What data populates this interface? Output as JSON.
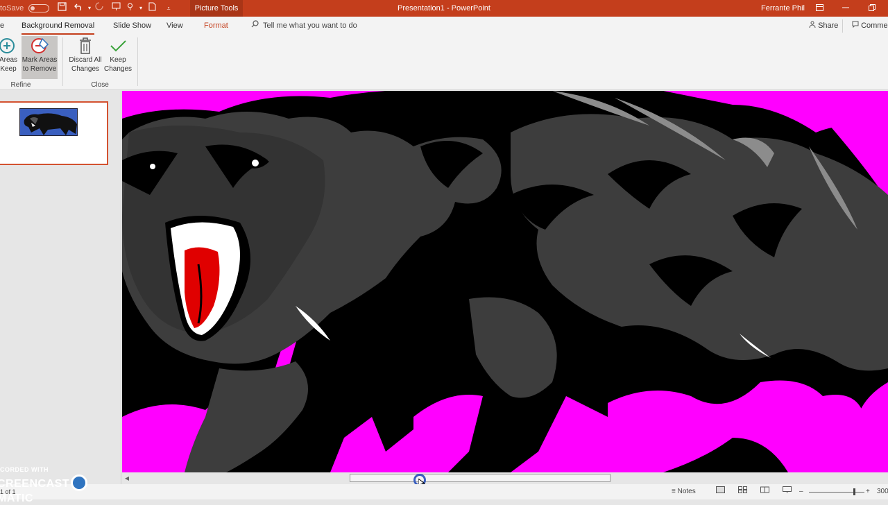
{
  "titlebar": {
    "autosave_label": "toSave",
    "autosave_state": "Off",
    "context_tab": "Picture Tools",
    "doc_title": "Presentation1 - PowerPoint",
    "user_name": "Ferrante Phil"
  },
  "tabs": {
    "file": "e",
    "background_removal": "Background Removal",
    "slide_show": "Slide Show",
    "view": "View",
    "format": "Format",
    "tell_me": "Tell me what you want to do",
    "share": "Share",
    "comments": "Comme"
  },
  "ribbon": {
    "mark_keep_line1": "Areas",
    "mark_keep_line2": "Keep",
    "mark_remove_line1": "Mark Areas",
    "mark_remove_line2": "to Remove",
    "discard_line1": "Discard All",
    "discard_line2": "Changes",
    "keep_line1": "Keep",
    "keep_line2": "Changes",
    "group_refine": "Refine",
    "group_close": "Close"
  },
  "statusbar": {
    "notes": "Notes",
    "zoom": "300"
  },
  "watermark": {
    "line1": "CORDED WITH",
    "brand_left": "CREENCAST",
    "brand_right": "MATIC",
    "slide_count": "1 of 1"
  },
  "colors": {
    "accent": "#c43e1c",
    "removal_magenta": "#ff00ff",
    "panther_body": "#3d3d3d",
    "panther_outline": "#000000",
    "mouth_red": "#e00000"
  }
}
